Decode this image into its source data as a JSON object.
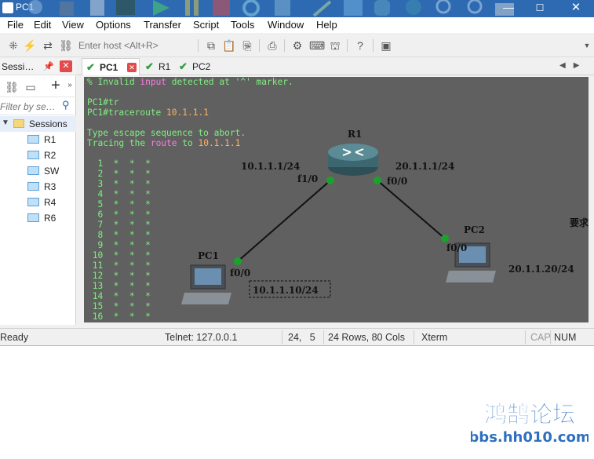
{
  "window": {
    "title": "PC1",
    "controls": {
      "minimize": "—",
      "maximize": "☐",
      "close": "✕"
    }
  },
  "menu": [
    "File",
    "Edit",
    "View",
    "Options",
    "Transfer",
    "Script",
    "Tools",
    "Window",
    "Help"
  ],
  "toolbar": {
    "host_placeholder": "Enter host <Alt+R>"
  },
  "sessions_panel": {
    "title": "Sessi…",
    "filter_placeholder": "Filter by se…",
    "folder": "Sessions",
    "items": [
      "R1",
      "R2",
      "SW",
      "R3",
      "R4",
      "R6"
    ]
  },
  "tabs": [
    {
      "label": "PC1",
      "active": true
    },
    {
      "label": "R1",
      "active": false
    },
    {
      "label": "PC2",
      "active": false
    }
  ],
  "terminal": {
    "error_prefix": "% Invalid ",
    "error_kw": "input",
    "error_suffix": " detected at '^' marker.",
    "prompt1": "PC1#tr",
    "prompt2_cmd": "PC1#traceroute ",
    "prompt2_ip": "10.1.1.1",
    "escape_line": "Type escape sequence to abort.",
    "tracing_prefix": "Tracing the ",
    "tracing_kw": "route",
    "tracing_mid": " to ",
    "tracing_ip": "10.1.1.1",
    "hops": [
      "  1  *  *  *",
      "  2  *  *  *",
      "  3  *  *  *",
      "  4  *  *  *",
      "  5  *  *  *",
      "  6  *  *  *",
      "  7  *  *  *",
      "  8  *  *  *",
      "  9  *  *  *",
      " 10  *  *  *",
      " 11  *  *  *",
      " 12  *  *  *",
      " 13  *  *  *",
      " 14  *  *  *",
      " 15  *  *  *",
      " 16  *  *  *"
    ]
  },
  "topology": {
    "router_name": "R1",
    "r1_left_ip": "10.1.1.1/24",
    "r1_left_if": "f1/0",
    "r1_right_ip": "20.1.1.1/24",
    "r1_right_if": "f0/0",
    "pc1_name": "PC1",
    "pc1_if": "f0/0",
    "pc1_ip": "10.1.1.10/24",
    "pc2_name": "PC2",
    "pc2_if": "f0/0",
    "pc2_ip": "20.1.1.20/24",
    "side_note": "要求"
  },
  "status": {
    "ready": "Ready",
    "connection": "Telnet: 127.0.0.1",
    "cursor": "24,   5",
    "size": "24 Rows, 80 Cols",
    "term_type": "Xterm",
    "cap": "CAP",
    "num": "NUM"
  },
  "watermark": {
    "title": "鸿鹄论坛",
    "url": "bbs.hh010.com"
  },
  "colors": {
    "titlebar": "#2d6ab1",
    "terminal_bg": "#606060",
    "terminal_text": "#7ff07f",
    "keyword_pink": "#ff79e5",
    "keyword_orange": "#ffb060",
    "link_dot": "#1aa32a"
  }
}
